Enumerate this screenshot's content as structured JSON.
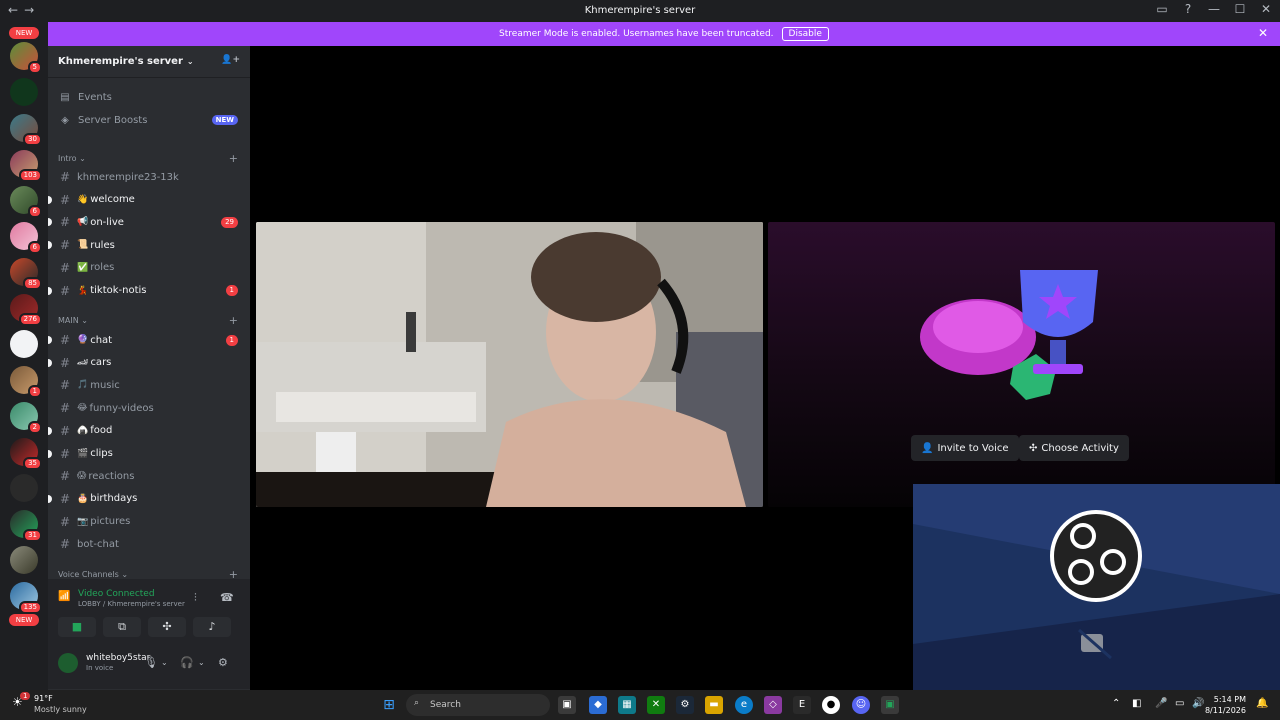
{
  "window": {
    "title": "Khmerempire's server",
    "back": "←",
    "forward": "→",
    "controls": [
      "▭",
      "?",
      "—",
      "☐",
      "✕"
    ]
  },
  "banner": {
    "text": "Streamer Mode is enabled. Usernames have been truncated.",
    "button": "Disable",
    "close": "✕"
  },
  "servers": {
    "new_top": "NEW",
    "new_bottom": "NEW",
    "badges": [
      "5",
      "30",
      "103",
      "6",
      "6",
      "85",
      "276",
      "1",
      "2",
      "35",
      "31",
      "135"
    ]
  },
  "server": {
    "name": "Khmerempire's server",
    "chevron": "⌄",
    "invite_icon": "👤+"
  },
  "nav": {
    "events": "Events",
    "boosts": "Server Boosts",
    "boosts_badge": "NEW"
  },
  "categories": {
    "intro": "Intro",
    "main": "MAIN",
    "voice": "Voice Channels",
    "plus": "+"
  },
  "channels_intro": [
    {
      "emoji": "",
      "name": "khmerempire23-13k",
      "count": ""
    },
    {
      "emoji": "👋",
      "name": "welcome",
      "count": ""
    },
    {
      "emoji": "📢",
      "name": "on-live",
      "count": "29"
    },
    {
      "emoji": "📜",
      "name": "rules",
      "count": ""
    },
    {
      "emoji": "✅",
      "name": "roles",
      "count": ""
    },
    {
      "emoji": "💃",
      "name": "tiktok-notis",
      "count": "1"
    }
  ],
  "channels_main": [
    {
      "emoji": "🔮",
      "name": "chat",
      "count": "1"
    },
    {
      "emoji": "🏎",
      "name": "cars",
      "count": ""
    },
    {
      "emoji": "🎵",
      "name": "music",
      "count": ""
    },
    {
      "emoji": "😂",
      "name": "funny-videos",
      "count": ""
    },
    {
      "emoji": "🍙",
      "name": "food",
      "count": ""
    },
    {
      "emoji": "🎬",
      "name": "clips",
      "count": ""
    },
    {
      "emoji": "😱",
      "name": "reactions",
      "count": ""
    },
    {
      "emoji": "🎂",
      "name": "birthdays",
      "count": ""
    },
    {
      "emoji": "📷",
      "name": "pictures",
      "count": ""
    },
    {
      "emoji": "",
      "name": "bot-chat",
      "count": ""
    }
  ],
  "voice": {
    "status": "Video Connected",
    "location": "LOBBY / Khmerempire's server"
  },
  "user": {
    "name": "whiteboy5star",
    "status": "In voice"
  },
  "stage": {
    "invite": "Invite to Voice",
    "activity": "Choose Activity"
  },
  "taskbar": {
    "weather_temp": "91°F",
    "weather_desc": "Mostly sunny",
    "search": "Search",
    "time": "5:14 PM",
    "date": "8/11/2026",
    "alert": "1"
  },
  "colors": {
    "banner": "#a046fb",
    "voice_connected": "#23a55a",
    "badge": "#f23f43",
    "blurple": "#5865f2"
  }
}
